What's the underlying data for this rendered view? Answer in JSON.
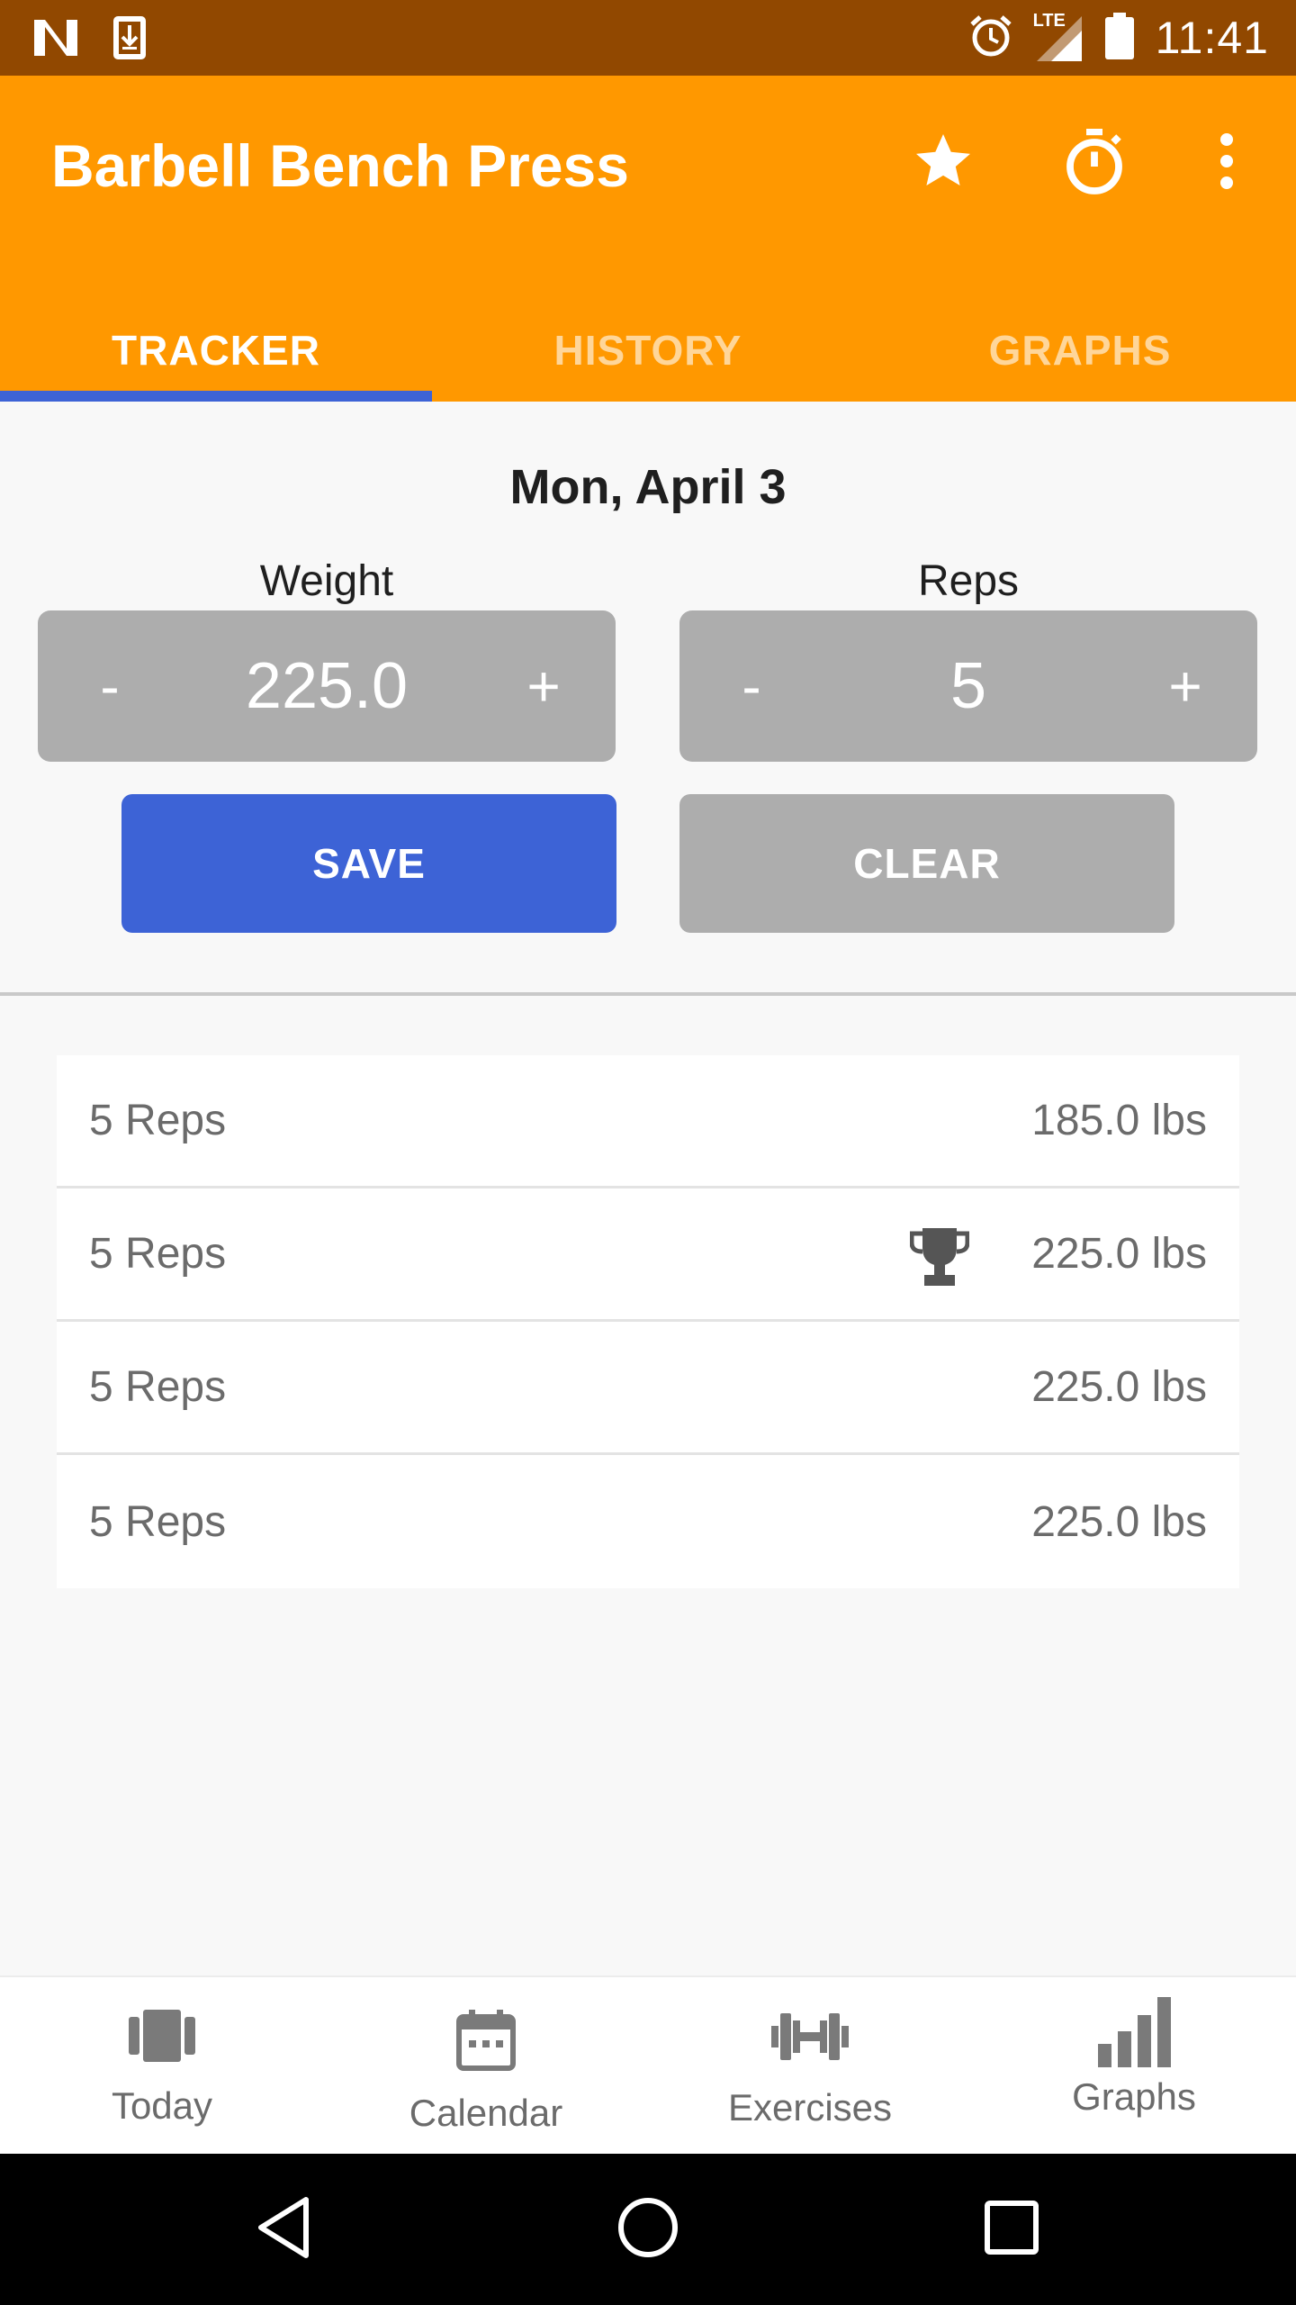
{
  "status_bar": {
    "time": "11:41",
    "network_label": "LTE",
    "icons": [
      "netflix-n-icon",
      "download-icon",
      "alarm-icon",
      "signal-icon",
      "battery-icon"
    ]
  },
  "app_bar": {
    "title": "Barbell Bench Press",
    "actions": [
      "star-icon",
      "stopwatch-icon",
      "more-vert-icon"
    ],
    "color": "#ff9800"
  },
  "tabs": [
    {
      "label": "TRACKER",
      "active": true
    },
    {
      "label": "HISTORY",
      "active": false
    },
    {
      "label": "GRAPHS",
      "active": false
    }
  ],
  "tracker": {
    "date": "Mon, April 3",
    "weight": {
      "label": "Weight",
      "value": "225.0",
      "minus": "-",
      "plus": "+"
    },
    "reps": {
      "label": "Reps",
      "value": "5",
      "minus": "-",
      "plus": "+"
    },
    "save_label": "SAVE",
    "clear_label": "CLEAR",
    "accent": "#3d63d6"
  },
  "sets": [
    {
      "reps": "5 Reps",
      "weight": "185.0 lbs",
      "record": false
    },
    {
      "reps": "5 Reps",
      "weight": "225.0 lbs",
      "record": true
    },
    {
      "reps": "5 Reps",
      "weight": "225.0 lbs",
      "record": false
    },
    {
      "reps": "5 Reps",
      "weight": "225.0 lbs",
      "record": false
    }
  ],
  "bottom_nav": [
    {
      "label": "Today",
      "icon": "today-icon"
    },
    {
      "label": "Calendar",
      "icon": "calendar-icon"
    },
    {
      "label": "Exercises",
      "icon": "dumbbell-icon"
    },
    {
      "label": "Graphs",
      "icon": "bar-chart-icon"
    }
  ],
  "system_nav": [
    "back-icon",
    "home-icon",
    "recents-icon"
  ]
}
